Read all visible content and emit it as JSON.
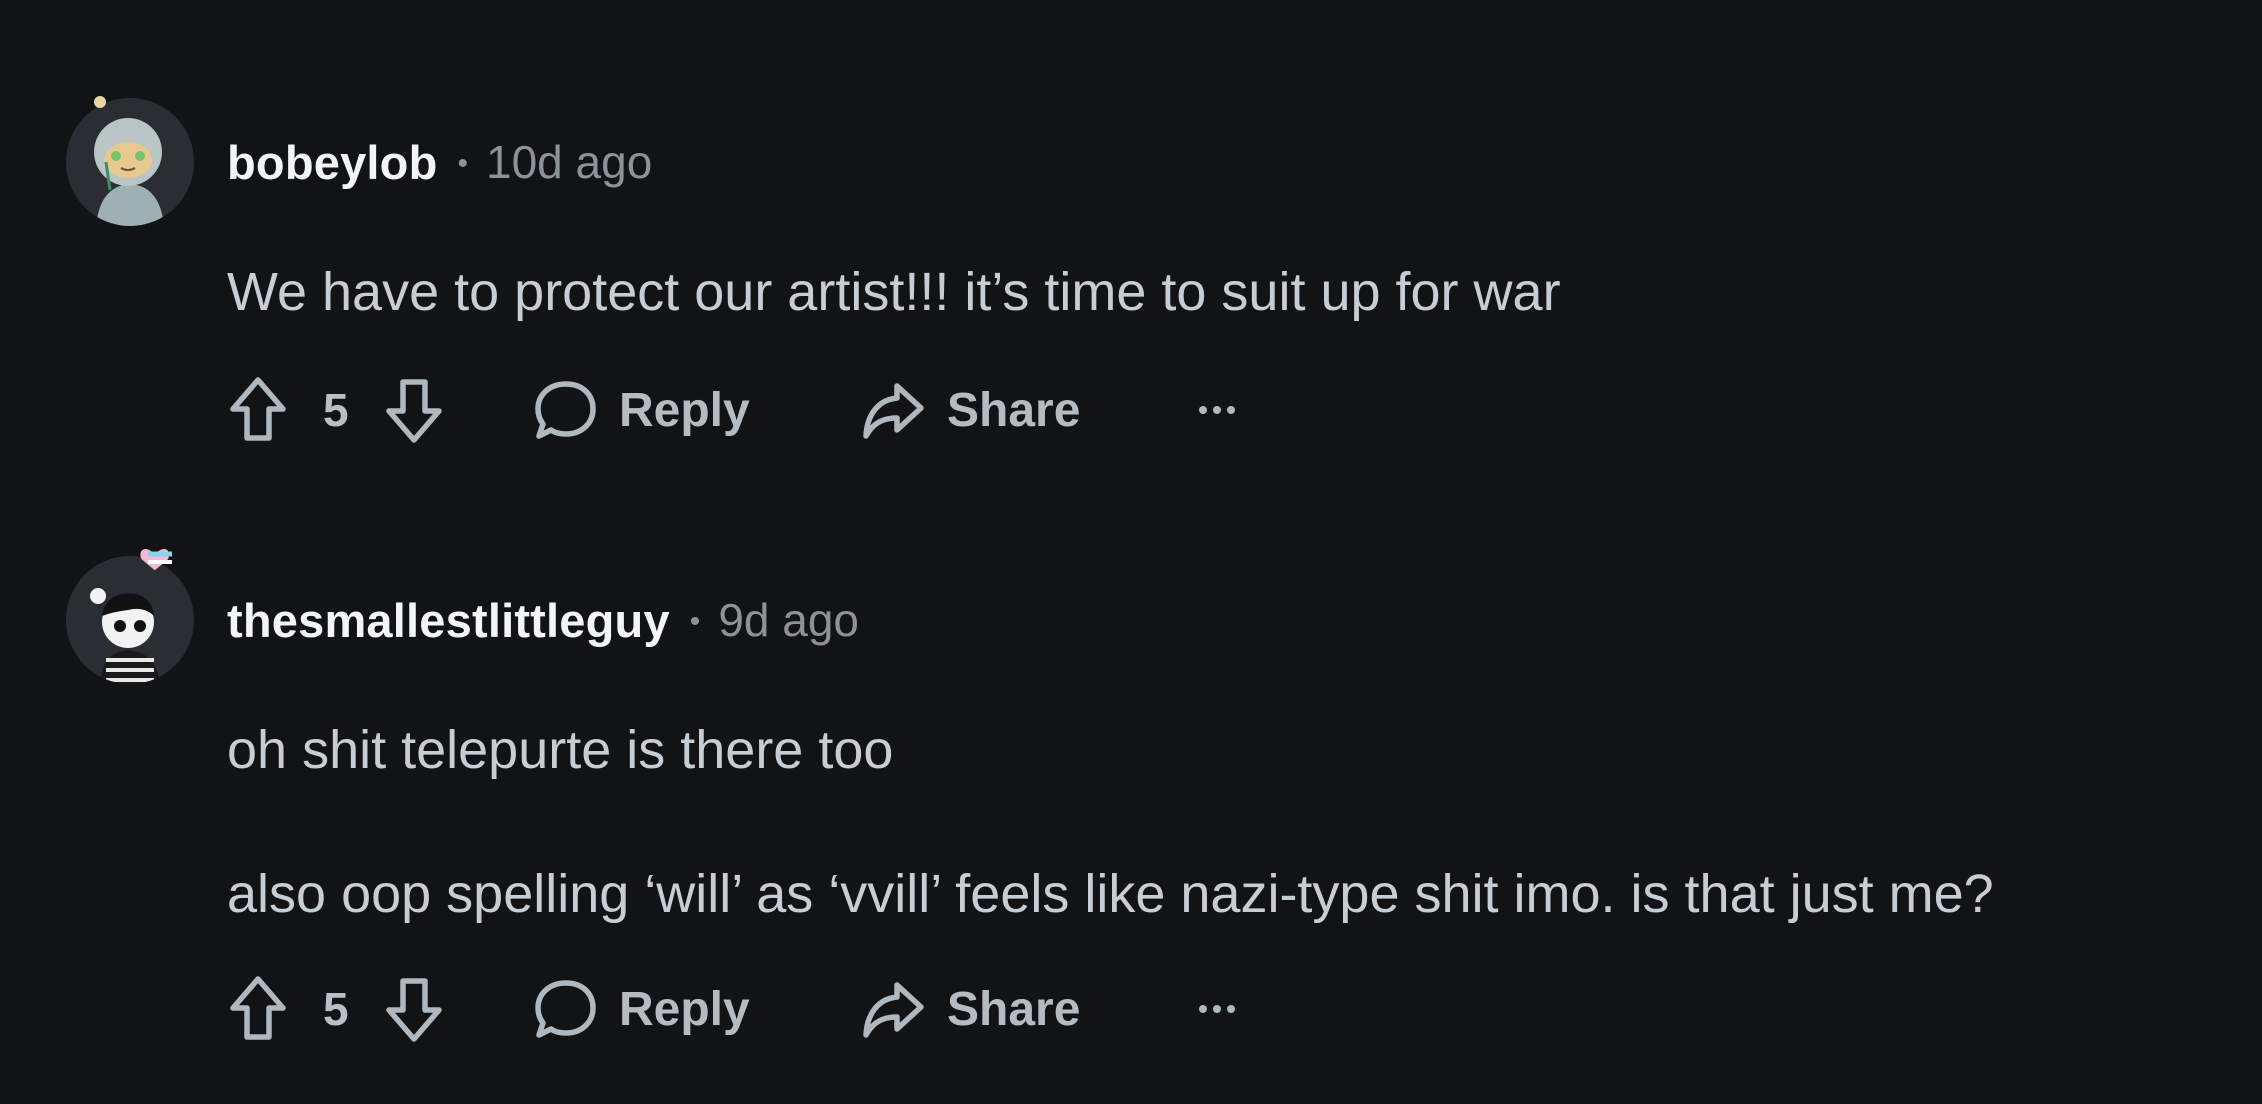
{
  "comments": [
    {
      "username": "bobeylob",
      "time": "10d ago",
      "paragraphs": [
        "We have to protect our artist!!! it’s time to suit up for war"
      ],
      "votes": "5",
      "reply_label": "Reply",
      "share_label": "Share",
      "more_label": "···"
    },
    {
      "username": "thesmallestlittleguy",
      "time": "9d ago",
      "paragraphs": [
        "oh shit telepurte is there too",
        "also oop spelling ‘will’ as ‘vvill’ feels like nazi-type shit imo. is that just me?"
      ],
      "votes": "5",
      "reply_label": "Reply",
      "share_label": "Share",
      "more_label": "···"
    }
  ],
  "separator": "•",
  "icons": {
    "upvote": "arrow-up-outline-icon",
    "downvote": "arrow-down-outline-icon",
    "reply": "speech-bubble-icon",
    "share": "share-arrow-icon",
    "more": "ellipsis-icon"
  },
  "colors": {
    "background": "#121315",
    "username": "#f2f4f5",
    "meta": "#8b9298",
    "body": "#c7ced3",
    "action": "#b4bcc2"
  }
}
